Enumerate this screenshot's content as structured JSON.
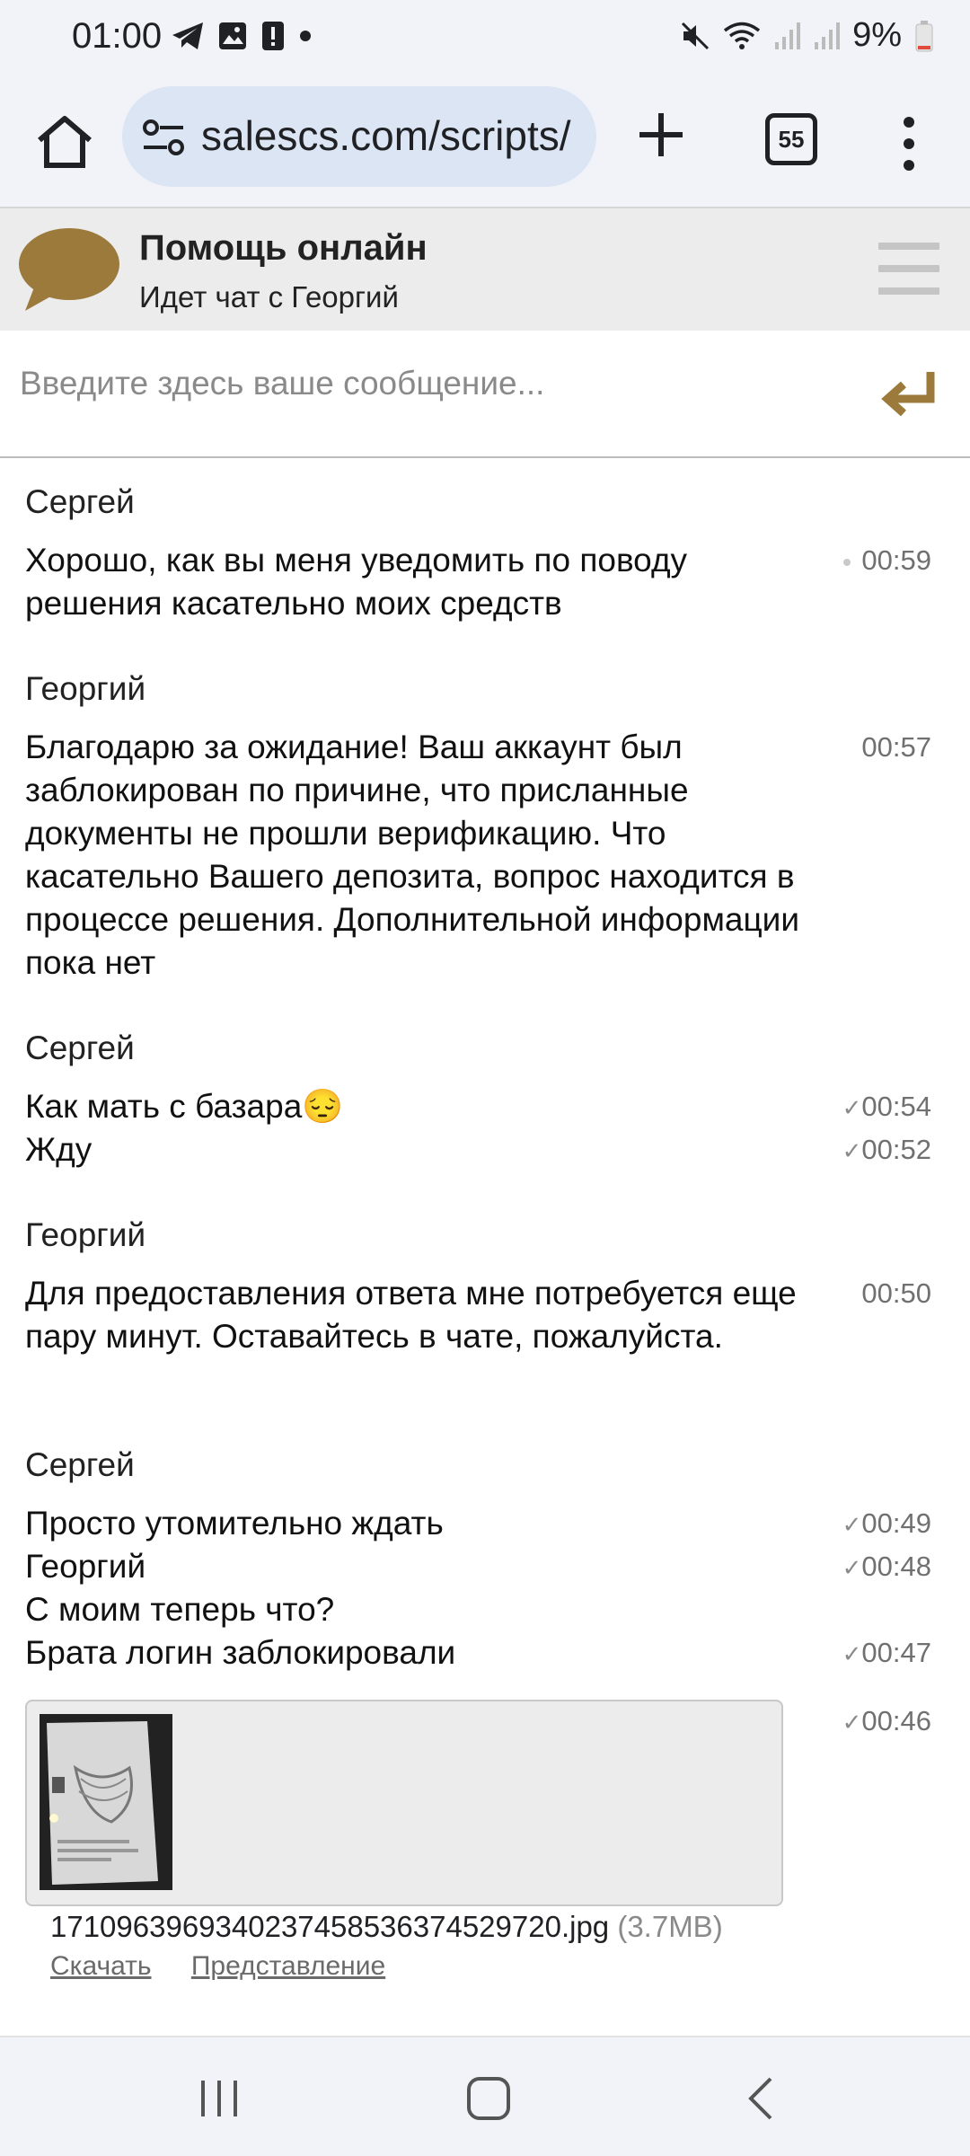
{
  "status_bar": {
    "time": "01:00",
    "battery": "9%",
    "icons": [
      "telegram-icon",
      "gallery-icon",
      "alert-icon",
      "dot-icon",
      "mute-icon",
      "wifi-icon",
      "signal-icon",
      "signal-icon",
      "battery-icon"
    ]
  },
  "browser": {
    "url": "salescs.com/scripts/",
    "tab_count": "55"
  },
  "chat_header": {
    "title": "Помощь онлайн",
    "subtitle": "Идет чат с Георгий"
  },
  "composer": {
    "placeholder": "Введите здесь ваше сообщение..."
  },
  "messages": [
    {
      "sender": "Сергей",
      "lines": [
        {
          "text": "Хорошо, как вы меня уведомить по поводу решения  касательно моих средств",
          "time": "00:59",
          "status": "dot"
        }
      ]
    },
    {
      "sender": "Георгий",
      "lines": [
        {
          "text": "Благодарю за ожидание!  Ваш аккаунт был заблокирован по причине, что присланные документы не прошли верификацию. Что касательно Вашего депозита, вопрос находится в процессе решения. Дополнительной информации пока нет",
          "time": "00:57",
          "status": ""
        }
      ]
    },
    {
      "sender": "Сергей",
      "lines": [
        {
          "text": "Как мать с базара😔",
          "time": "00:54",
          "status": "✓"
        },
        {
          "text": "Жду",
          "time": "00:52",
          "status": "✓"
        }
      ]
    },
    {
      "sender": "Георгий",
      "lines": [
        {
          "text": "Для предоставления ответа мне потребуется еще пару минут. Оставайтесь в чате, пожалуйста.",
          "time": "00:50",
          "status": ""
        }
      ]
    },
    {
      "sender": "Сергей",
      "lines": [
        {
          "text": "Просто утомительно ждать",
          "time": "00:49",
          "status": "✓"
        },
        {
          "text": "Георгий",
          "time": "00:48",
          "status": "✓"
        },
        {
          "text": "С моим теперь что?",
          "time": "",
          "status": ""
        },
        {
          "text": "Брата логин заблокировали",
          "time": "00:47",
          "status": "✓"
        }
      ]
    }
  ],
  "attachment": {
    "time": "00:46",
    "status": "✓",
    "filename": "17109639693402374585363745297​20.jpg",
    "size": "(3.7MB)",
    "download_label": "Скачать",
    "view_label": "Представление"
  }
}
